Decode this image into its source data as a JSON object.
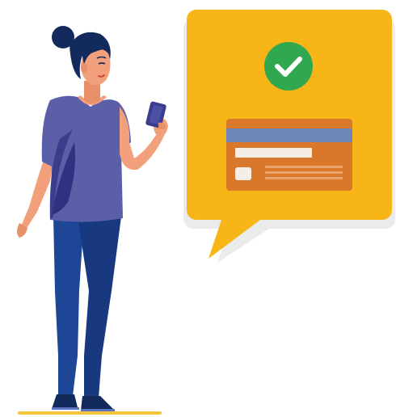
{
  "illustration": {
    "subject": "payment-confirmed",
    "icons": {
      "status": "check-circle-icon",
      "card": "credit-card-icon",
      "phone": "smartphone-icon"
    },
    "colors": {
      "bubble": "#F7B517",
      "bubble_shadow": "#E3A30F",
      "check": "#2FA84F",
      "card_body": "#D9782A",
      "card_stripe": "#6F87B8",
      "shirt": "#5A5FA8",
      "shirt_shadow": "#3A3D8C",
      "pants": "#1E4696",
      "hair": "#132B5C",
      "skin": "#F2A07B",
      "ground": "#F7C43E"
    }
  }
}
